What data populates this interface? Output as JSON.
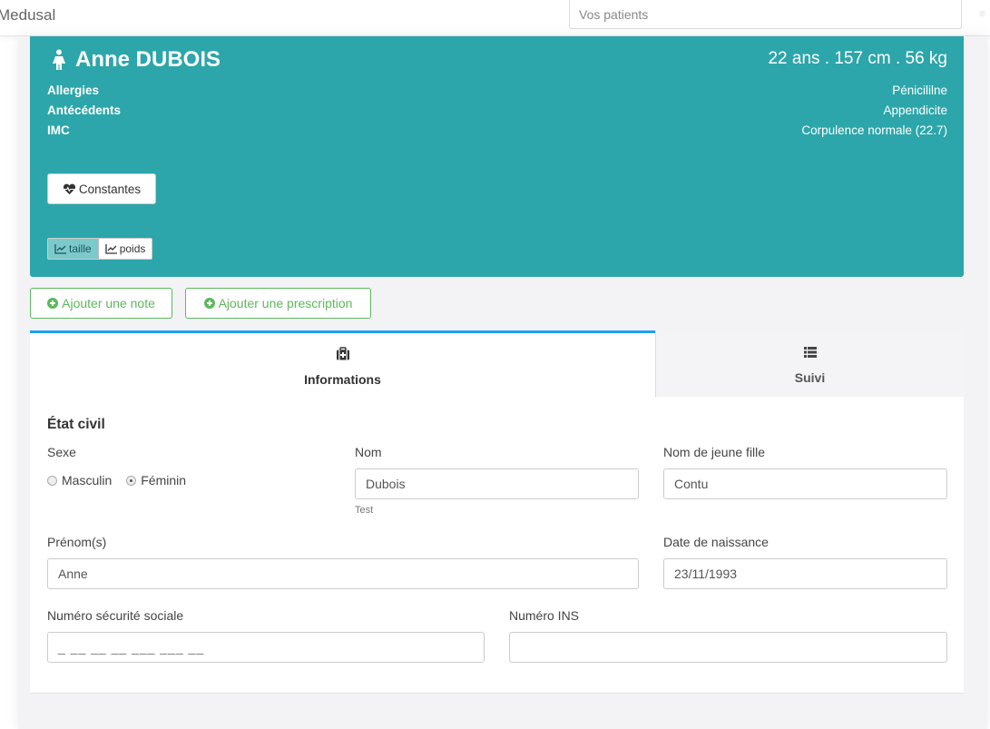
{
  "app": {
    "brand": "Medusal",
    "search_placeholder": "Vos patients"
  },
  "patient": {
    "name": "Anne DUBOIS",
    "stats": "22 ans . 157 cm . 56 kg",
    "info": [
      {
        "label": "Allergies",
        "value": "Pénicililne"
      },
      {
        "label": "Antécédents",
        "value": "Appendicite"
      },
      {
        "label": "IMC",
        "value": "Corpulence normale (22.7)"
      }
    ],
    "constantes_label": "Constantes",
    "chart_toggle": [
      {
        "label": "taille",
        "active": true
      },
      {
        "label": "poids",
        "active": false
      }
    ]
  },
  "actions": {
    "add_note": "Ajouter une note",
    "add_prescription": "Ajouter une prescription"
  },
  "tabs": [
    {
      "label": "Informations",
      "icon": "medkit-icon",
      "active": true
    },
    {
      "label": "Suivi",
      "icon": "list-icon",
      "active": false
    }
  ],
  "form": {
    "section_title": "État civil",
    "sexe": {
      "label": "Sexe",
      "options": [
        "Masculin",
        "Féminin"
      ],
      "selected": "Féminin"
    },
    "nom": {
      "label": "Nom",
      "value": "Dubois",
      "help": "Test"
    },
    "nom_jeune_fille": {
      "label": "Nom de jeune fille",
      "value": "Contu"
    },
    "prenoms": {
      "label": "Prénom(s)",
      "value": "Anne"
    },
    "date_naissance": {
      "label": "Date de naissance",
      "value": "23/11/1993"
    },
    "secu": {
      "label": "Numéro sécurité sociale",
      "value": "_ __ __ __ ___ ___ __"
    },
    "ins": {
      "label": "Numéro INS",
      "value": ""
    }
  },
  "colors": {
    "header_teal": "#2ca6aa",
    "success_green": "#5cb85c",
    "tab_accent": "#1da1f2"
  }
}
